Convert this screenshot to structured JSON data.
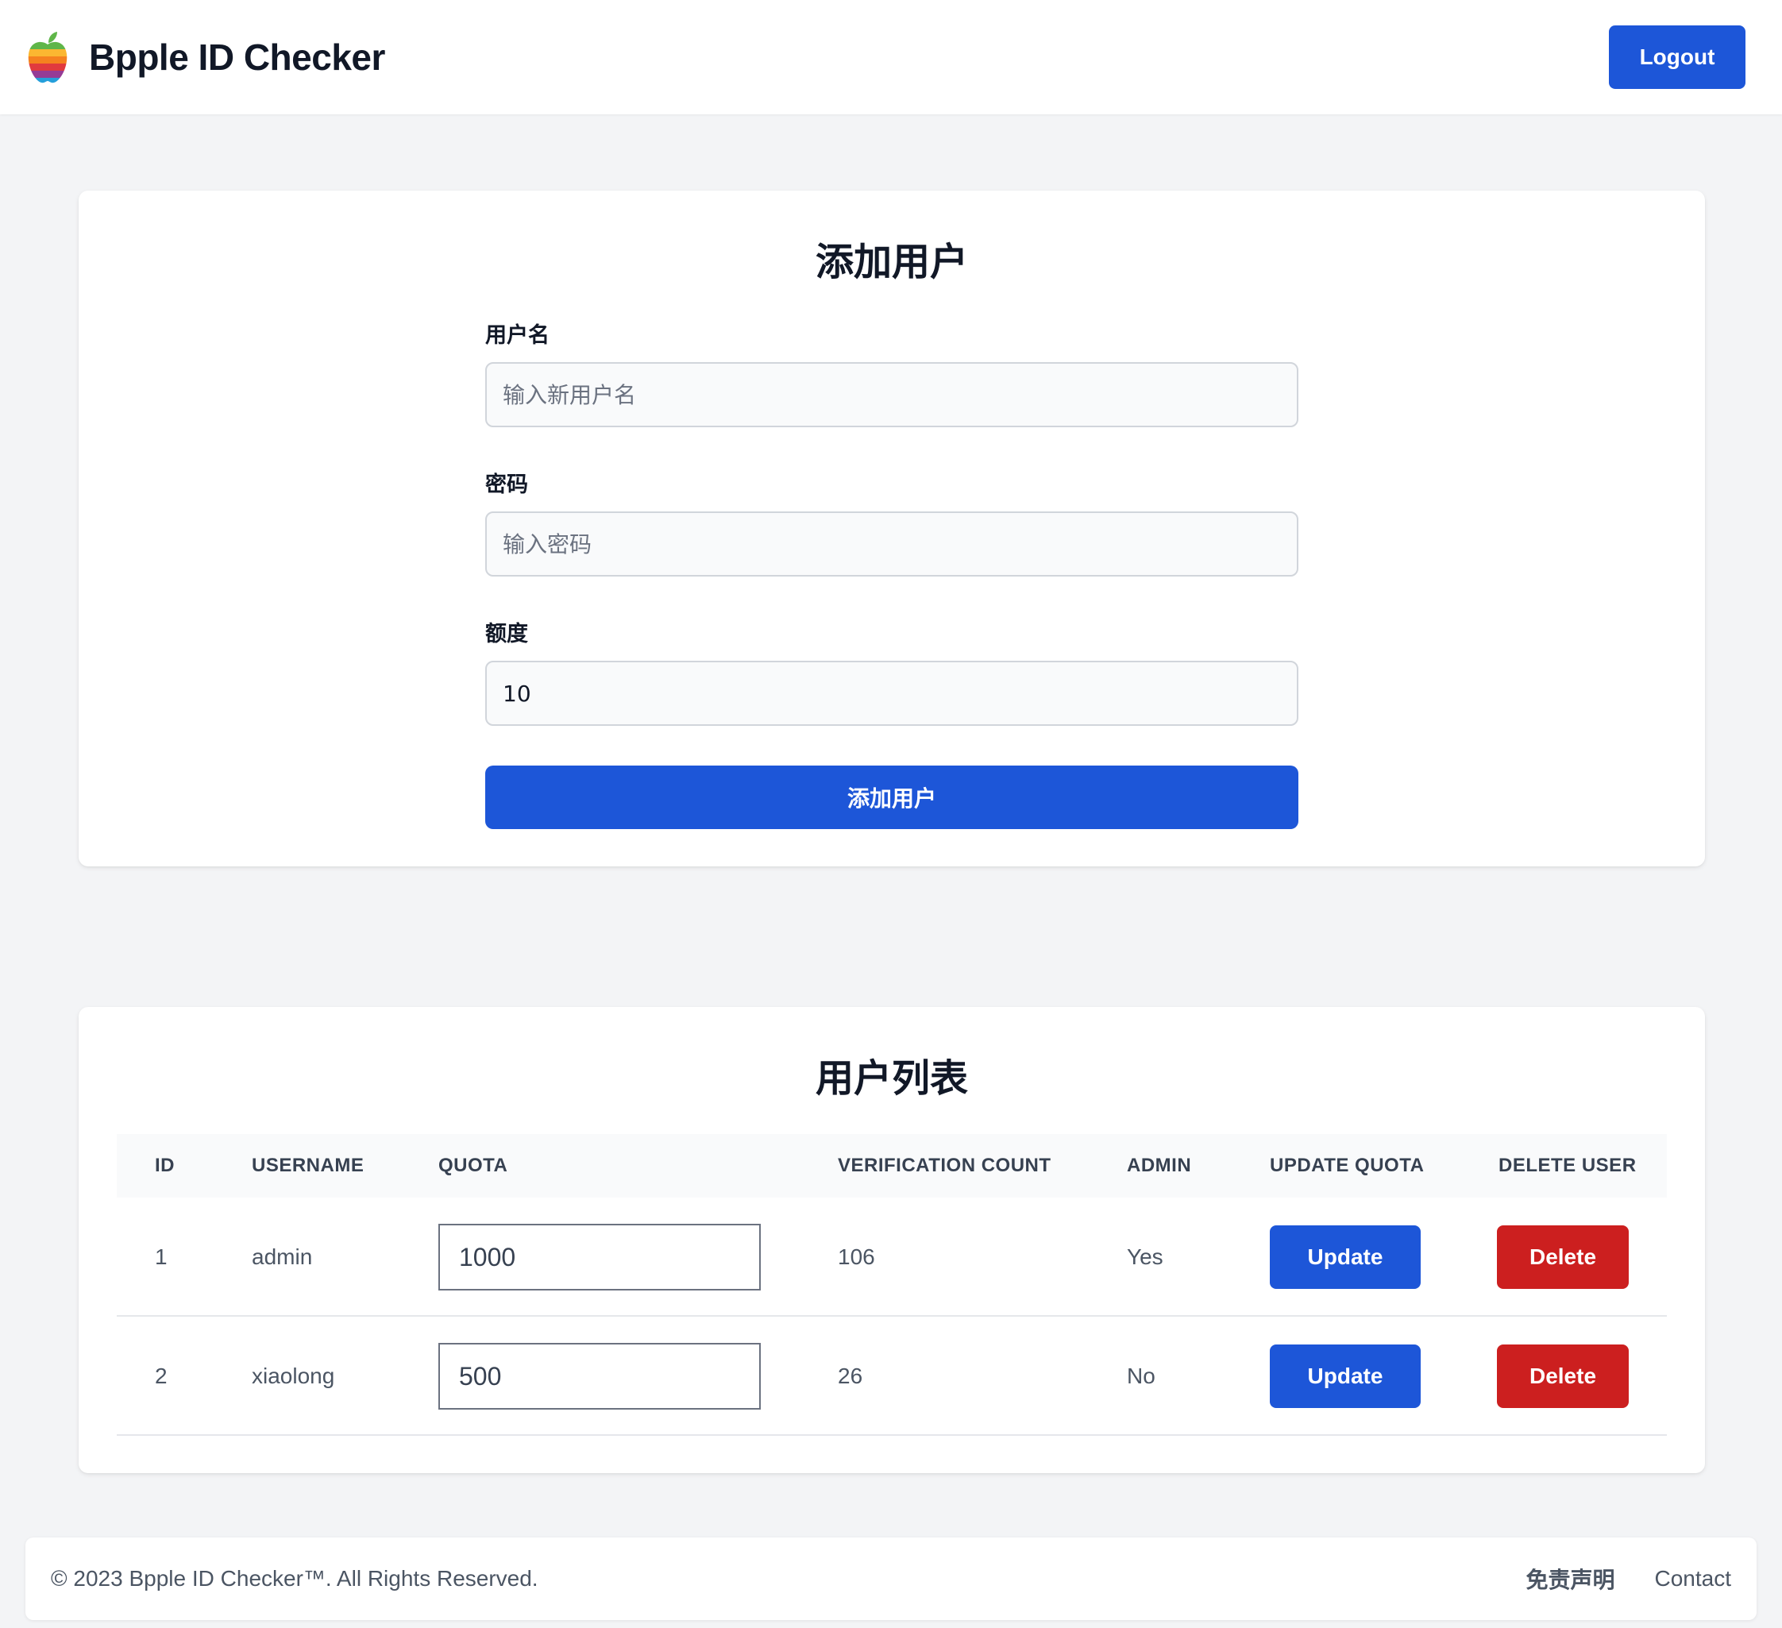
{
  "header": {
    "app_title": "Bpple ID Checker",
    "logout_label": "Logout"
  },
  "add_user": {
    "title": "添加用户",
    "username_label": "用户名",
    "username_placeholder": "输入新用户名",
    "password_label": "密码",
    "password_placeholder": "输入密码",
    "quota_label": "额度",
    "quota_value": "10",
    "submit_label": "添加用户"
  },
  "user_list": {
    "title": "用户列表",
    "columns": [
      "ID",
      "USERNAME",
      "QUOTA",
      "VERIFICATION COUNT",
      "ADMIN",
      "UPDATE QUOTA",
      "DELETE USER"
    ],
    "rows": [
      {
        "id": "1",
        "username": "admin",
        "quota": "1000",
        "verification_count": "106",
        "admin": "Yes",
        "update_label": "Update",
        "delete_label": "Delete"
      },
      {
        "id": "2",
        "username": "xiaolong",
        "quota": "500",
        "verification_count": "26",
        "admin": "No",
        "update_label": "Update",
        "delete_label": "Delete"
      }
    ]
  },
  "footer": {
    "copyright": "© 2023 Bpple ID Checker™. All Rights Reserved.",
    "disclaimer_label": "免责声明",
    "contact_label": "Contact"
  },
  "colors": {
    "primary_blue": "#1d56d8",
    "danger_red": "#cc1f1f",
    "page_background": "#f3f4f6"
  },
  "icons": {
    "brand_logo": "apple-rainbow-logo-icon"
  }
}
